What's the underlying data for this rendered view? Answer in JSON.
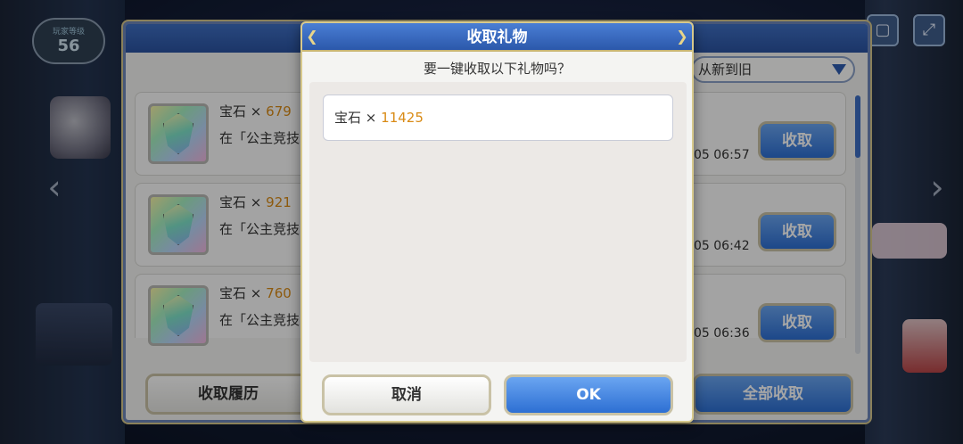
{
  "hud": {
    "level_label": "玩家等级",
    "level_value": "56"
  },
  "gift_list": {
    "sort_label": "从新到旧",
    "rows": [
      {
        "item": "宝石",
        "times": "×",
        "qty": "679",
        "desc": "在「公主竞技",
        "time": "05 06:57",
        "button": "收取"
      },
      {
        "item": "宝石",
        "times": "×",
        "qty": "921",
        "desc": "在「公主竞技",
        "time": "05 06:42",
        "button": "收取"
      },
      {
        "item": "宝石",
        "times": "×",
        "qty": "760",
        "desc": "在「公主竞技",
        "time": "05 06:36",
        "button": "收取"
      }
    ],
    "history_button": "收取履历",
    "receive_all_button": "全部收取"
  },
  "dialog": {
    "title": "收取礼物",
    "question": "要一键收取以下礼物吗？",
    "summary": {
      "item": "宝石",
      "times": "×",
      "qty": "11425"
    },
    "cancel_button": "取消",
    "ok_button": "OK"
  }
}
